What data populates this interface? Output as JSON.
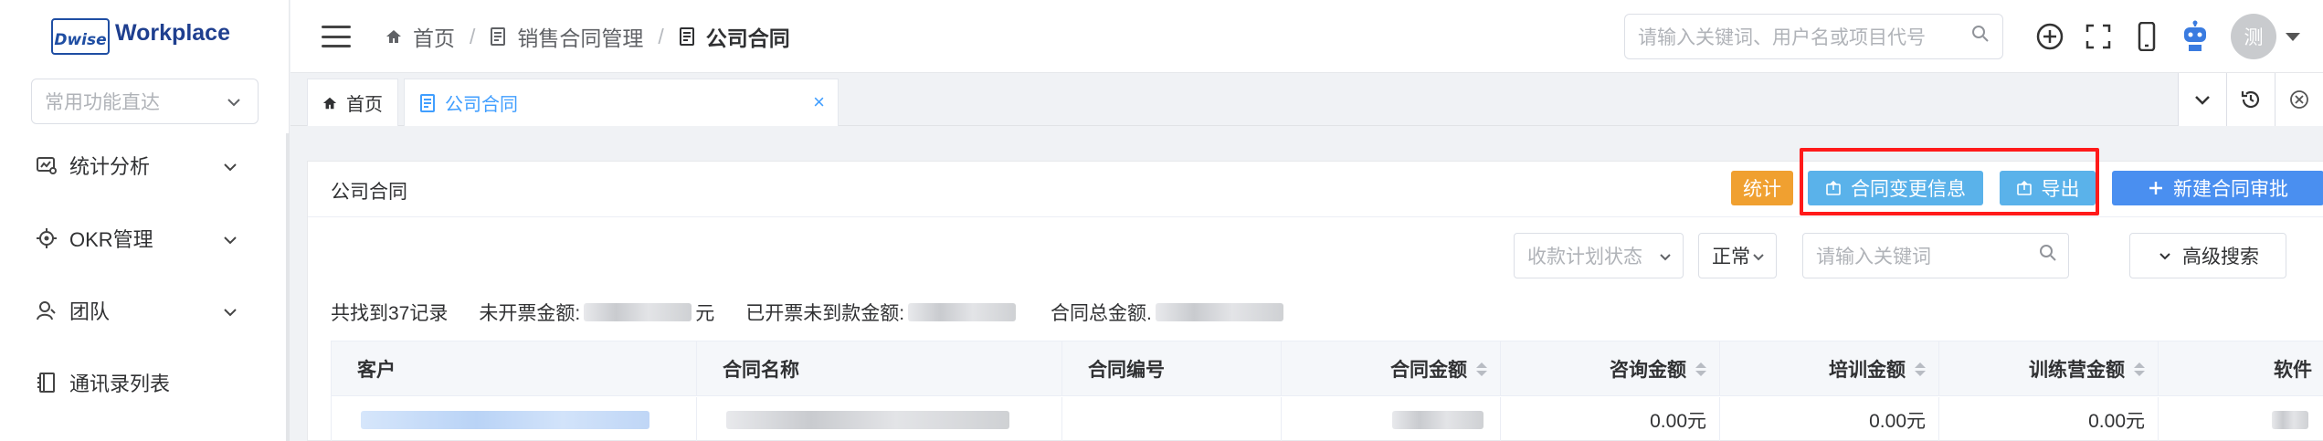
{
  "app": {
    "logo_mark": "Dwise",
    "logo_text": "Workplace"
  },
  "sidebar": {
    "quick_select_placeholder": "常用功能直达",
    "items": [
      {
        "label": "统计分析",
        "icon": "chart-icon",
        "has_children": true
      },
      {
        "label": "OKR管理",
        "icon": "target-icon",
        "has_children": true
      },
      {
        "label": "团队",
        "icon": "team-icon",
        "has_children": true
      },
      {
        "label": "通讯录列表",
        "icon": "book-icon",
        "has_children": false
      }
    ]
  },
  "header": {
    "breadcrumb": [
      {
        "label": "首页",
        "icon": "home-icon"
      },
      {
        "label": "销售合同管理",
        "icon": "document-icon"
      },
      {
        "label": "公司合同",
        "icon": "document-icon"
      }
    ],
    "search_placeholder": "请输入关键词、用户名或项目代号",
    "avatar_text": "测",
    "icons": [
      "plus-circle-icon",
      "fullscreen-icon",
      "mobile-icon",
      "robot-icon"
    ]
  },
  "tabs": [
    {
      "label": "首页",
      "active": false
    },
    {
      "label": "公司合同",
      "active": true,
      "close": "×"
    }
  ],
  "card": {
    "title": "公司合同",
    "buttons": {
      "stat": "统计",
      "change_info": "合同变更信息",
      "export": "导出",
      "new_approval": "新建合同审批"
    },
    "filters": {
      "plan_status_placeholder": "收款计划状态",
      "status_value": "正常",
      "keyword_placeholder": "请输入关键词",
      "advanced": "高级搜索"
    },
    "summary": {
      "count_text": "共找到37记录",
      "uninvoiced_label": "未开票金额:",
      "uninvoiced_unit": "元",
      "invoiced_unpaid_label": "已开票未到款金额:",
      "total_label": "合同总金额."
    }
  },
  "table": {
    "columns": [
      {
        "label": "客户",
        "sortable": false
      },
      {
        "label": "合同名称",
        "sortable": false
      },
      {
        "label": "合同编号",
        "sortable": false
      },
      {
        "label": "合同金额",
        "sortable": true
      },
      {
        "label": "咨询金额",
        "sortable": true
      },
      {
        "label": "培训金额",
        "sortable": true
      },
      {
        "label": "训练营金额",
        "sortable": true
      },
      {
        "label": "软件",
        "sortable": false
      }
    ],
    "rows": [
      {
        "consult": "0.00元",
        "training": "0.00元",
        "camp": "0.00元"
      }
    ]
  }
}
